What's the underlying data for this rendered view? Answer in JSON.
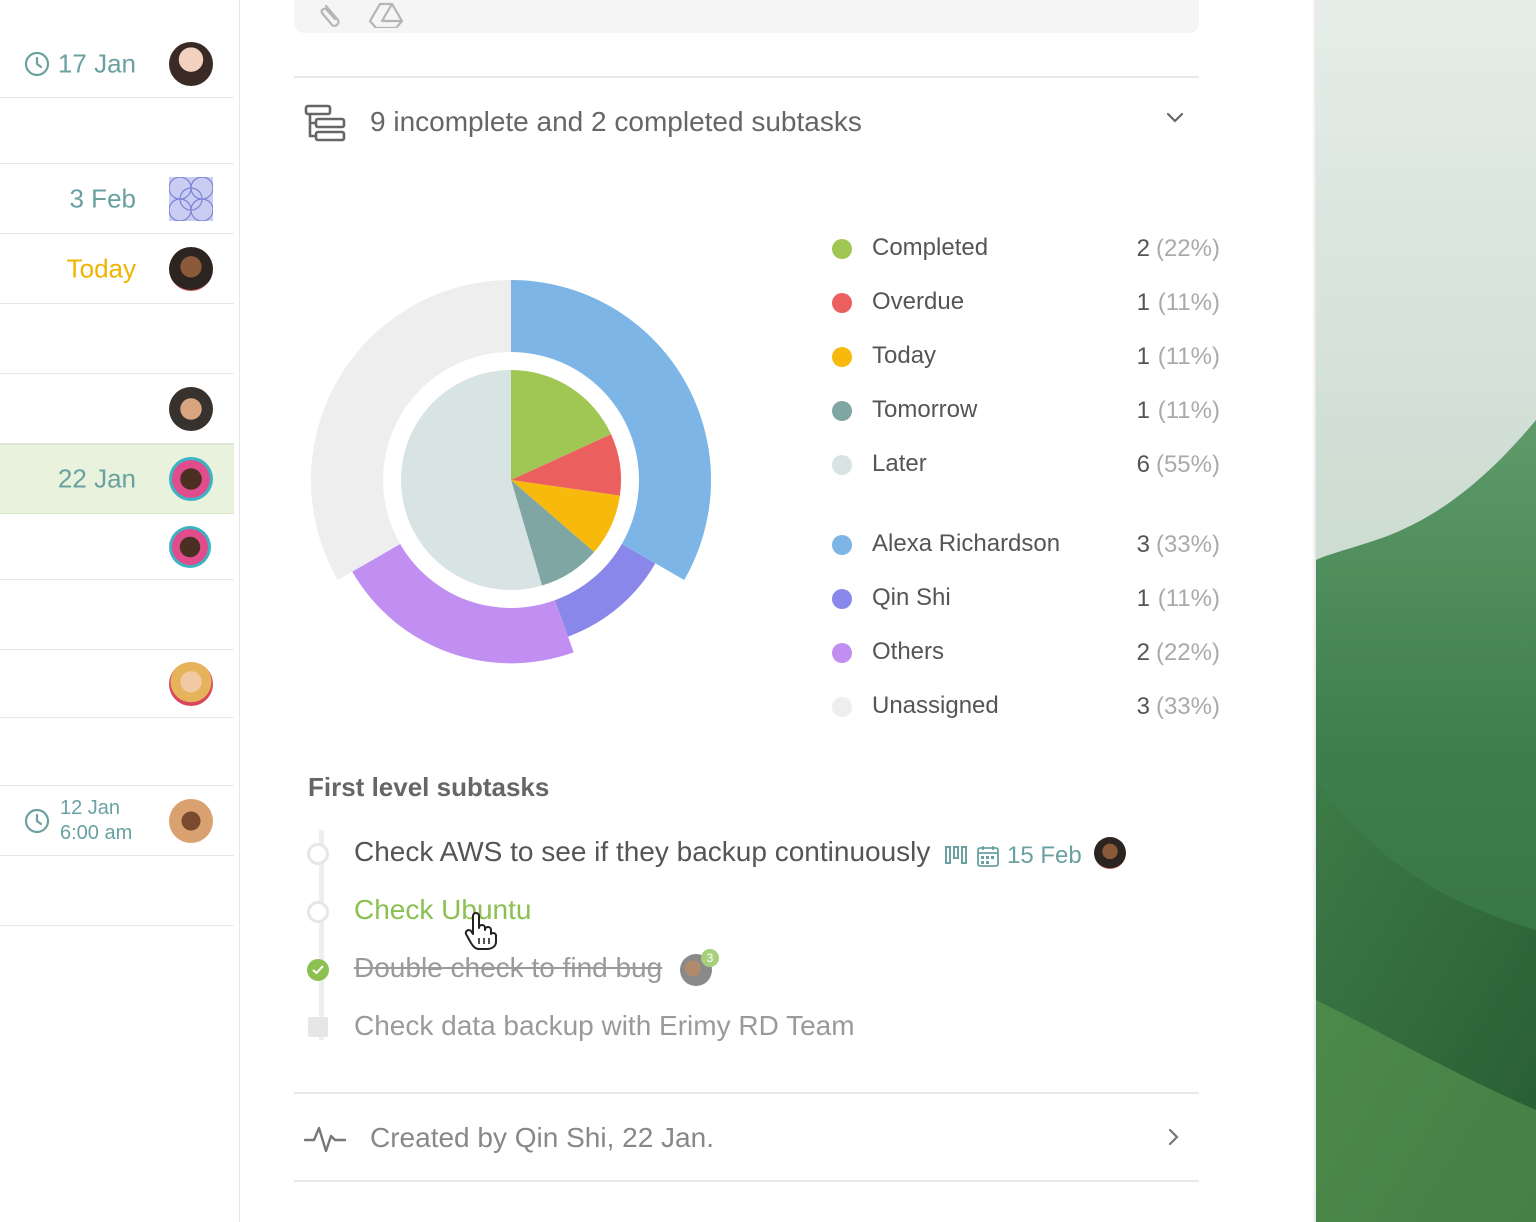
{
  "task_list": {
    "rows": [
      {
        "date": "17 Jan",
        "date_type": "time"
      },
      {
        "date": "",
        "date_type": "none"
      },
      {
        "date": "3 Feb",
        "date_type": "normal"
      },
      {
        "date": "Today",
        "date_type": "today"
      },
      {
        "date": "",
        "date_type": "none"
      },
      {
        "date": "",
        "date_type": "none"
      },
      {
        "date": "22 Jan",
        "date_type": "normal",
        "selected": true
      },
      {
        "date": "",
        "date_type": "none"
      },
      {
        "date": "",
        "date_type": "none"
      },
      {
        "date": "",
        "date_type": "none"
      },
      {
        "date": "",
        "date_type": "none"
      },
      {
        "date_line1": "12 Jan",
        "date_line2": "6:00 am",
        "date_type": "time"
      },
      {
        "date": "",
        "date_type": "none"
      }
    ]
  },
  "subtasks": {
    "summary": "9 incomplete and 2 completed subtasks",
    "section_title": "First level subtasks",
    "items": [
      {
        "title": "Check AWS to see if they backup continuously",
        "due": "15 Feb",
        "state": "open"
      },
      {
        "title": "Check Ubuntu",
        "state": "hover"
      },
      {
        "title": "Double check to find bug",
        "state": "done",
        "avatar_badge": "3"
      },
      {
        "title": "Check data backup with Erimy RD Team",
        "state": "archived"
      }
    ]
  },
  "activity": {
    "created": "Created by Qin Shi, 22 Jan."
  },
  "chart_data": {
    "type": "pie",
    "title": "",
    "status": [
      {
        "name": "Completed",
        "value": 2,
        "percent": "(22%)",
        "color": "#a0c653"
      },
      {
        "name": "Overdue",
        "value": 1,
        "percent": "(11%)",
        "color": "#ec5f5f"
      },
      {
        "name": "Today",
        "value": 1,
        "percent": "(11%)",
        "color": "#f6b90c"
      },
      {
        "name": "Tomorrow",
        "value": 1,
        "percent": "(11%)",
        "color": "#80a6a4"
      },
      {
        "name": "Later",
        "value": 6,
        "percent": "(55%)",
        "color": "#d8e3e3"
      }
    ],
    "assignees": [
      {
        "name": "Alexa Richardson",
        "value": 3,
        "percent": "(33%)",
        "color": "#7cb5e6"
      },
      {
        "name": "Qin Shi",
        "value": 1,
        "percent": "(11%)",
        "color": "#8a87ea"
      },
      {
        "name": "Others",
        "value": 2,
        "percent": "(22%)",
        "color": "#c18ef2"
      },
      {
        "name": "Unassigned",
        "value": 3,
        "percent": "(33%)",
        "color": "#eeeeee"
      }
    ]
  }
}
